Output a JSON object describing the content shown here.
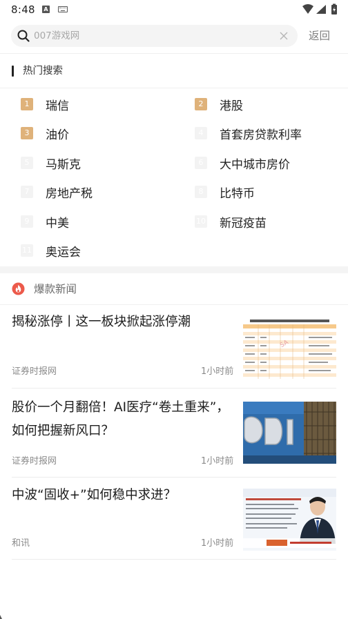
{
  "status_bar": {
    "time": "8:48"
  },
  "search": {
    "placeholder": "007游戏网",
    "back_label": "返回"
  },
  "hot_search": {
    "title": "热门搜索",
    "items": [
      {
        "rank": "1",
        "label": "瑞信",
        "highlight": true
      },
      {
        "rank": "2",
        "label": "港股",
        "highlight": true
      },
      {
        "rank": "3",
        "label": "油价",
        "highlight": true
      },
      {
        "rank": "4",
        "label": "首套房贷款利率",
        "highlight": false
      },
      {
        "rank": "5",
        "label": "马斯克",
        "highlight": false
      },
      {
        "rank": "6",
        "label": "大中城市房价",
        "highlight": false
      },
      {
        "rank": "7",
        "label": "房地产税",
        "highlight": false
      },
      {
        "rank": "8",
        "label": "比特币",
        "highlight": false
      },
      {
        "rank": "9",
        "label": "中美",
        "highlight": false
      },
      {
        "rank": "10",
        "label": "新冠疫苗",
        "highlight": false
      },
      {
        "rank": "11",
        "label": "奥运会",
        "highlight": false
      }
    ]
  },
  "hot_news": {
    "title": "爆款新闻",
    "items": [
      {
        "title": "揭秘涨停丨这一板块掀起涨停潮",
        "source": "证券时报网",
        "time": "1小时前"
      },
      {
        "title": "股价一个月翻倍！AI医疗“卷土重来”，如何把握新风口？",
        "source": "证券时报网",
        "time": "1小时前"
      },
      {
        "title": "中波“固收+”如何稳中求进？",
        "source": "和讯",
        "time": "1小时前"
      }
    ]
  },
  "colors": {
    "rank_top": "#dfb27a",
    "rank_normal": "#f3f3f3",
    "fire": "#ec5a4b",
    "text_primary": "#1d1d1d",
    "text_secondary": "#8a8a8a"
  }
}
